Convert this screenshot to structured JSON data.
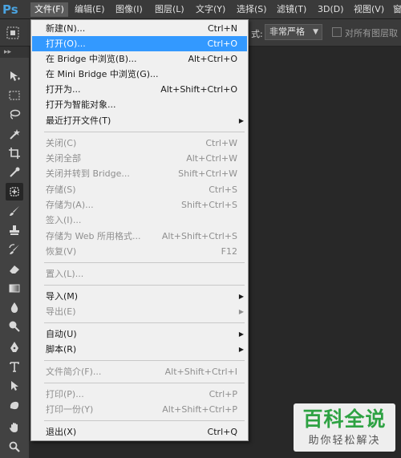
{
  "app": {
    "logo": "Ps"
  },
  "menubar": {
    "items": [
      {
        "label": "文件(F)",
        "active": true
      },
      {
        "label": "编辑(E)"
      },
      {
        "label": "图像(I)"
      },
      {
        "label": "图层(L)"
      },
      {
        "label": "文字(Y)"
      },
      {
        "label": "选择(S)"
      },
      {
        "label": "滤镜(T)"
      },
      {
        "label": "3D(D)"
      },
      {
        "label": "视图(V)"
      },
      {
        "label": "窗"
      }
    ]
  },
  "options": {
    "partial_label": "式:",
    "style_value": "非常严格",
    "checkbox_label": "对所有图层取"
  },
  "toolbox": {
    "grip": "▸▸"
  },
  "file_menu": {
    "items": [
      {
        "label": "新建(N)...",
        "shortcut": "Ctrl+N"
      },
      {
        "label": "打开(O)...",
        "shortcut": "Ctrl+O",
        "highlight": true
      },
      {
        "label": "在 Bridge 中浏览(B)...",
        "shortcut": "Alt+Ctrl+O"
      },
      {
        "label": "在 Mini Bridge 中浏览(G)...",
        "shortcut": ""
      },
      {
        "label": "打开为...",
        "shortcut": "Alt+Shift+Ctrl+O"
      },
      {
        "label": "打开为智能对象...",
        "shortcut": ""
      },
      {
        "label": "最近打开文件(T)",
        "shortcut": "",
        "submenu": true
      },
      {
        "label": "关闭(C)",
        "shortcut": "Ctrl+W",
        "disabled": true
      },
      {
        "label": "关闭全部",
        "shortcut": "Alt+Ctrl+W",
        "disabled": true
      },
      {
        "label": "关闭并转到 Bridge...",
        "shortcut": "Shift+Ctrl+W",
        "disabled": true
      },
      {
        "label": "存储(S)",
        "shortcut": "Ctrl+S",
        "disabled": true
      },
      {
        "label": "存储为(A)...",
        "shortcut": "Shift+Ctrl+S",
        "disabled": true
      },
      {
        "label": "签入(I)...",
        "shortcut": "",
        "disabled": true
      },
      {
        "label": "存储为 Web 所用格式...",
        "shortcut": "Alt+Shift+Ctrl+S",
        "disabled": true
      },
      {
        "label": "恢复(V)",
        "shortcut": "F12",
        "disabled": true
      },
      {
        "label": "置入(L)...",
        "shortcut": "",
        "disabled": true
      },
      {
        "label": "导入(M)",
        "shortcut": "",
        "submenu": true
      },
      {
        "label": "导出(E)",
        "shortcut": "",
        "submenu": true,
        "disabled": true
      },
      {
        "label": "自动(U)",
        "shortcut": "",
        "submenu": true
      },
      {
        "label": "脚本(R)",
        "shortcut": "",
        "submenu": true
      },
      {
        "label": "文件简介(F)...",
        "shortcut": "Alt+Shift+Ctrl+I",
        "disabled": true
      },
      {
        "label": "打印(P)...",
        "shortcut": "Ctrl+P",
        "disabled": true
      },
      {
        "label": "打印一份(Y)",
        "shortcut": "Alt+Shift+Ctrl+P",
        "disabled": true
      },
      {
        "label": "退出(X)",
        "shortcut": "Ctrl+Q"
      }
    ],
    "submenu_glyph": "▶"
  },
  "watermark": {
    "line1": "百科全说",
    "line2": "助你轻松解决"
  },
  "colors": {
    "highlight": "#3399ff",
    "menubar_bg": "#3a3a3a",
    "workspace_bg": "#282828",
    "watermark_green": "#2ea243"
  }
}
